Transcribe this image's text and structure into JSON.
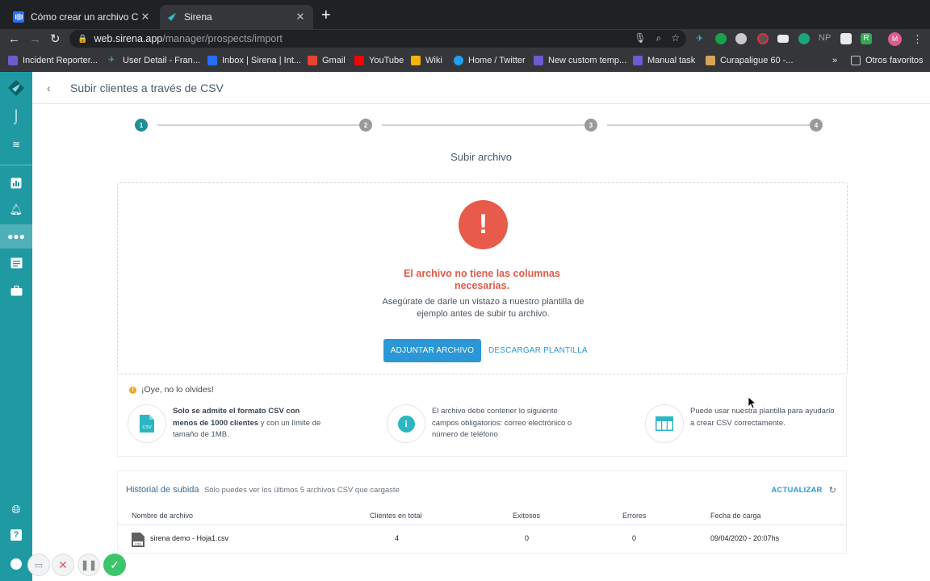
{
  "browser": {
    "tabs": [
      {
        "title": "Cómo crear un archivo CSV para",
        "active": false
      },
      {
        "title": "Sirena",
        "active": true
      }
    ],
    "url_host": "web.sirena.app",
    "url_path": "/manager/prospects/import",
    "bookmarks": [
      "Incident Reporter...",
      "User Detail - Fran...",
      "Inbox | Sirena | Int...",
      "Gmail",
      "YouTube",
      "Wiki",
      "Home / Twitter",
      "New custom temp...",
      "Manual task",
      "Curapaligue 60 -...",
      "»",
      "Otros favoritos"
    ],
    "extension_labels": {
      "np": "NP",
      "r": "R",
      "profile": "M"
    }
  },
  "page": {
    "title": "Subir clientes a través de CSV",
    "steps": [
      "1",
      "2",
      "3",
      "4"
    ],
    "current_step": 1,
    "subtitle": "Subir archivo"
  },
  "upload": {
    "error_symbol": "!",
    "error_title": "El archivo no tiene las columnas necesarias.",
    "error_desc": "Asegúrate de darle un vistazo a nuestro plantilla de ejemplo antes de subir tu archivo.",
    "attach_label": "ADJUNTAR ARCHIVO",
    "template_label": "DESCARGAR PLANTILLA"
  },
  "tips": {
    "heading": "¡Oye, no lo olvides!",
    "items": [
      {
        "bold": "Solo se admite el formato CSV con menos de 1000 clientes",
        "rest": " y con un límite de tamaño de 1MB."
      },
      {
        "bold": "",
        "rest": "El archivo debe contener lo siguiente campos obligatorios: correo electrónico o número de teléfono"
      },
      {
        "bold": "",
        "rest": "Puede usar nuestra plantilla para ayudarlo a crear CSV correctamente."
      }
    ],
    "csv_icon_label": "CSV"
  },
  "history": {
    "title": "Historial de subida",
    "note": "Sólo puedes ver los últimos 5 archivos CSV que cargaste",
    "refresh_label": "ACTUALIZAR",
    "columns": [
      "Nombre de archivo",
      "Clientes en total",
      "Exitosos",
      "Errores",
      "Fecha de carga"
    ],
    "rows": [
      {
        "file": "sirena demo - Hoja1.csv",
        "total": "4",
        "ok": "0",
        "errors": "0",
        "date": "09/04/2020 - 20:07hs"
      }
    ]
  },
  "colors": {
    "sidebar": "#1f9aa3",
    "accent": "#2b97d6",
    "error": "#e85b4a",
    "step_active": "#1f8e98",
    "step_inactive": "#9a9a9a"
  }
}
